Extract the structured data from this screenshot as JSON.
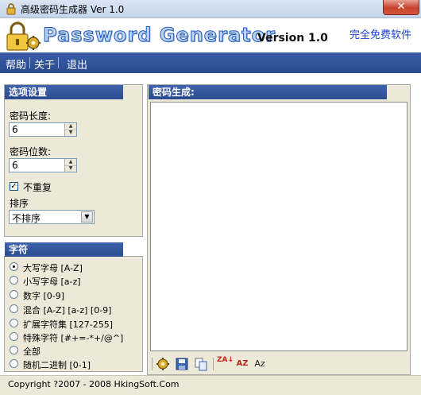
{
  "window": {
    "title": "高级密码生成器 Ver 1.0",
    "close_label": "✕"
  },
  "header": {
    "brand": "Password Generator",
    "version": "Version 1.0",
    "free_link": "完全免费软件"
  },
  "menu": {
    "items": [
      {
        "label": "帮助"
      },
      {
        "label": "关于"
      },
      {
        "label": "退出"
      }
    ]
  },
  "options": {
    "header": "选项设置",
    "length_label": "密码长度:",
    "length_value": "6",
    "count_label": "密码位数:",
    "count_value": "6",
    "no_repeat_label": "不重复",
    "no_repeat_checked": true,
    "sort_label": "排序",
    "sort_value": "不排序"
  },
  "charset": {
    "header": "字符",
    "options": [
      {
        "label": "大写字母 [A-Z]",
        "selected": true
      },
      {
        "label": "小写字母 [a-z]",
        "selected": false
      },
      {
        "label": "数字 [0-9]",
        "selected": false
      },
      {
        "label": "混合 [A-Z] [a-z] [0-9]",
        "selected": false
      },
      {
        "label": "扩展字符集 [127-255]",
        "selected": false
      },
      {
        "label": "特殊字符 [#+=-*+/@^]",
        "selected": false
      },
      {
        "label": "全部",
        "selected": false
      },
      {
        "label": "随机二进制 [0-1]",
        "selected": false
      }
    ]
  },
  "output": {
    "header": "密码生成:"
  },
  "toolbar": {
    "buttons": [
      {
        "icon": "generate-gear-icon"
      },
      {
        "icon": "save-icon"
      },
      {
        "icon": "copy-icon"
      },
      {
        "icon": "sort-za-icon",
        "text": "ZA"
      },
      {
        "icon": "sort-az-icon",
        "text": "AZ"
      },
      {
        "icon": "case-az-icon",
        "text": "Az"
      }
    ]
  },
  "status": {
    "text": "Copyright ?2007 - 2008 HkingSoft.Com"
  },
  "colors": {
    "menu_bar": "#2a4a8c",
    "section_header": "#2b4b8f",
    "panel": "#ece9d8",
    "link": "#1c3fd6",
    "brand_stroke": "#1f57b5"
  }
}
